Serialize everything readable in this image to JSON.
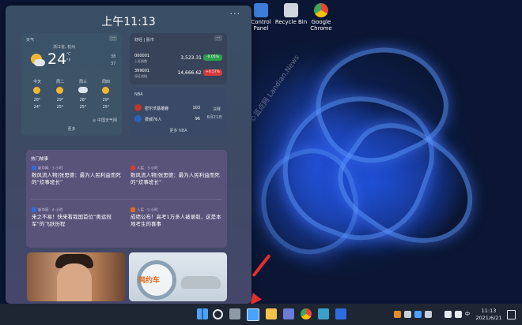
{
  "desktop": {
    "icons": [
      {
        "label": "Control\nPanel",
        "icon": "control-panel-icon",
        "color": "#3b7dd8"
      },
      {
        "label": "Recycle Bin",
        "icon": "recycle-bin-icon",
        "color": "#cfd6e0"
      },
      {
        "label": "Google\nChrome",
        "icon": "chrome-icon",
        "color": "#e9453a"
      }
    ],
    "watermark": "©蓝点网 Landian.News"
  },
  "widgets": {
    "time": "上午11:13",
    "more": "···",
    "weather": {
      "title": "天气",
      "location": "浙江省, 杭州",
      "temp": "24",
      "unit": "℃",
      "unit_f": "°F",
      "high": "38",
      "low": "37",
      "forecast": [
        {
          "day": "今天",
          "high": "28°",
          "low": "24°"
        },
        {
          "day": "周二",
          "high": "29°",
          "low": "25°"
        },
        {
          "day": "周三",
          "high": "28°",
          "low": "25°"
        },
        {
          "day": "周四",
          "high": "29°",
          "low": "25°"
        }
      ],
      "source": "◎ 中国天气网",
      "more_label": "更多"
    },
    "stocks": {
      "title": "财经 | 股市",
      "rows": [
        {
          "code": "000001",
          "name": "上证指数",
          "price": "3,523.31",
          "change": "-0.05%",
          "color": "#2e9e4f"
        },
        {
          "code": "399001",
          "name": "深证成指",
          "price": "14,666.62",
          "change": "+0.57%",
          "color": "#d83b3b"
        }
      ]
    },
    "nba": {
      "title": "NBA",
      "teams": [
        {
          "name": "密尔沃基雄鹿",
          "score": "103",
          "color": "#c2362b"
        },
        {
          "name": "费城76人",
          "score": "96",
          "color": "#2a63b8"
        }
      ],
      "status": "决赛",
      "date": "6月21日",
      "more_label": "更多 NBA"
    },
    "news": {
      "title": "热门故事",
      "items": [
        {
          "source": "新华网 · 3 小时",
          "headline": "数风流人物|张思德：最为人民利益而死的“炊事班长”",
          "color": "#2d6cdf"
        },
        {
          "source": "人民 · 3 小时",
          "headline": "数风流人物|张思德：最为人民利益而死的“炊事班长”",
          "color": "#d83b3b"
        },
        {
          "source": "新华网 · 4 小时",
          "headline": "来之不易！快来看我国首位“奥运冠军”的飞跃历程",
          "color": "#2d6cdf"
        },
        {
          "source": "人民 · 5 小时",
          "headline": "成绩公布！高考1万多人被录取，这是本地考生的喜事",
          "color": "#e06a1c"
        }
      ],
      "more_label": "···"
    },
    "photo2_text": "网约车"
  },
  "taskbar": {
    "time": "11:13",
    "date": "2021/6/21",
    "lang": "中"
  }
}
